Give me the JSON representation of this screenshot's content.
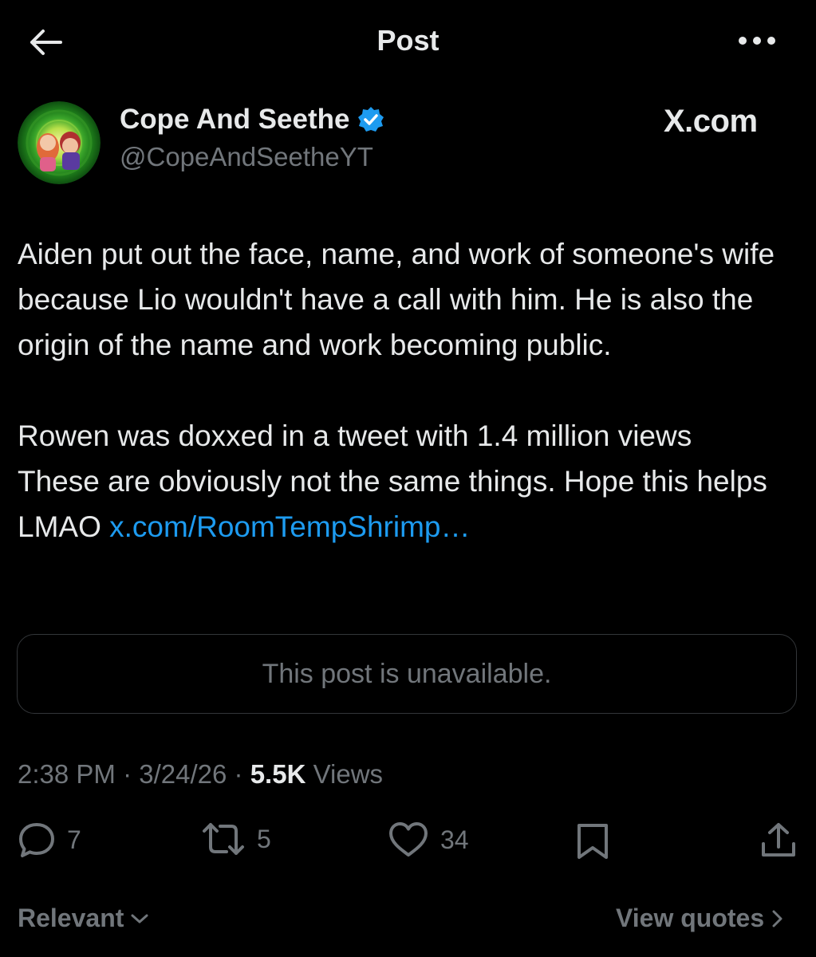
{
  "header": {
    "title": "Post",
    "back_icon": "arrow-left-icon",
    "more_icon": "more-horizontal-icon"
  },
  "author": {
    "name": "Cope And Seethe",
    "handle": "@CopeAndSeetheYT",
    "verified_color": "#1d9bf0"
  },
  "watermark": "X.com",
  "post": {
    "paragraph1": "Aiden put out the face, name, and work of someone's wife because Lio wouldn't have a call with him. He is also the origin of the name and work becoming public.",
    "paragraph2_line1": "Rowen was doxxed in a tweet with 1.4 million views",
    "paragraph2_line2": "These are obviously not the same things. Hope this helps LMAO ",
    "link_text": "x.com/RoomTempShrimp…"
  },
  "quoted": {
    "text": "This post is unavailable."
  },
  "meta": {
    "time": "2:38 PM",
    "date": "3/24/26",
    "views_count": "5.5K",
    "views_label": "Views",
    "separator": "·"
  },
  "actions": {
    "replies": "7",
    "reposts": "5",
    "likes": "34"
  },
  "footer": {
    "sort_label": "Relevant",
    "quotes_label": "View quotes"
  },
  "colors": {
    "background": "#000000",
    "text": "#e7e9ea",
    "secondary": "#71767b",
    "link": "#1d9bf0"
  }
}
